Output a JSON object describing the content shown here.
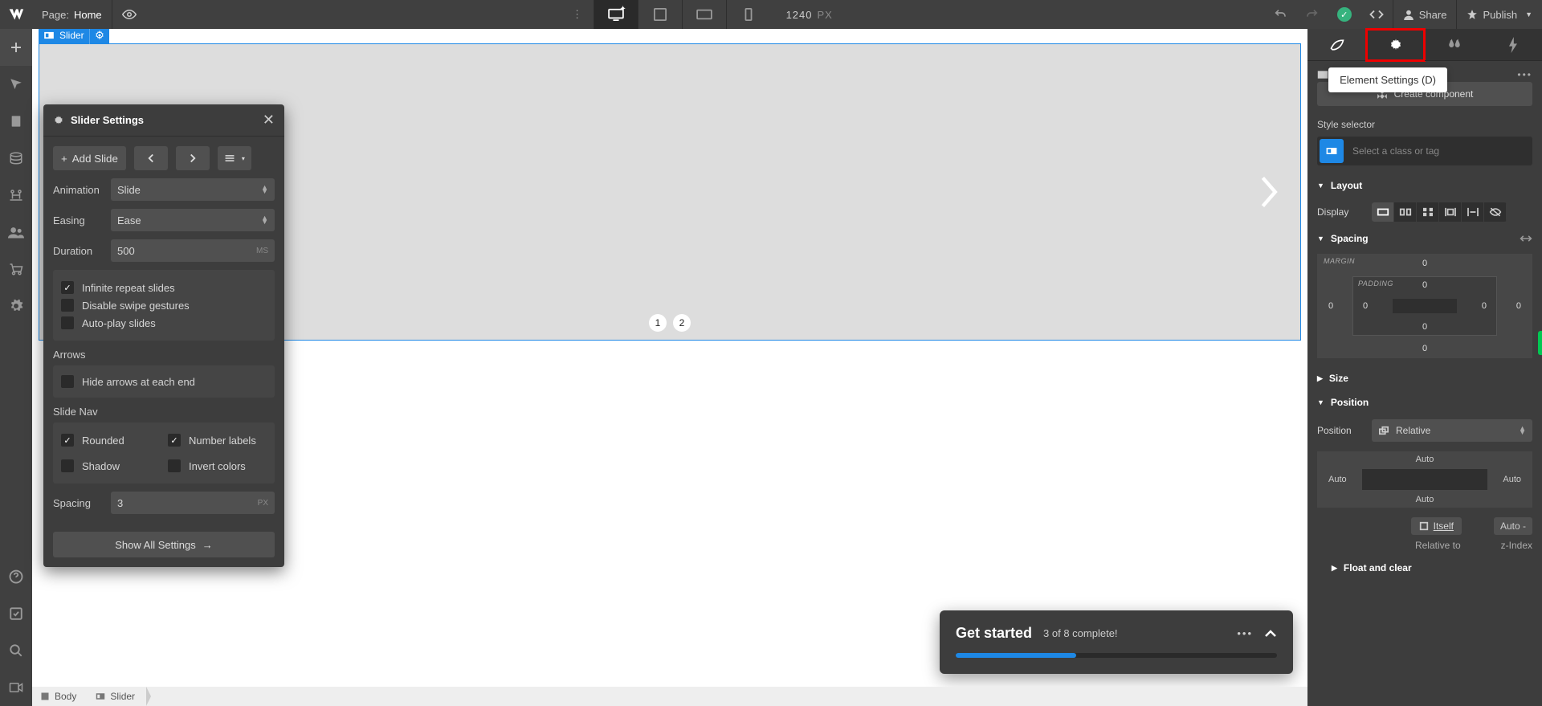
{
  "topbar": {
    "page_label": "Page:",
    "page_value": "Home",
    "width": "1240",
    "width_unit": "PX",
    "share": "Share",
    "publish": "Publish"
  },
  "slider_tag": "Slider",
  "slider_dots": [
    "1",
    "2"
  ],
  "panel": {
    "title": "Slider Settings",
    "add_slide": "Add Slide",
    "animation_lbl": "Animation",
    "animation_val": "Slide",
    "easing_lbl": "Easing",
    "easing_val": "Ease",
    "duration_lbl": "Duration",
    "duration_val": "500",
    "duration_unit": "MS",
    "chk_infinite": "Infinite repeat slides",
    "chk_swipe": "Disable swipe gestures",
    "chk_autoplay": "Auto-play slides",
    "arrows_lbl": "Arrows",
    "chk_hidearr": "Hide arrows at each end",
    "slidenav_lbl": "Slide Nav",
    "chk_rounded": "Rounded",
    "chk_numlbl": "Number labels",
    "chk_shadow": "Shadow",
    "chk_invert": "Invert colors",
    "spacing_lbl": "Spacing",
    "spacing_val": "3",
    "spacing_unit": "PX",
    "show_all": "Show All Settings"
  },
  "gs": {
    "title": "Get started",
    "progress": "3 of 8 complete!"
  },
  "breadcrumb": {
    "body": "Body",
    "slider": "Slider"
  },
  "tooltip": "Element Settings (D)",
  "rpanel": {
    "create_comp": "Create component",
    "style_selector_lbl": "Style selector",
    "style_selector_ph": "Select a class or tag",
    "layout": "Layout",
    "display_lbl": "Display",
    "spacing": "Spacing",
    "margin_lbl": "MARGIN",
    "padding_lbl": "PADDING",
    "size": "Size",
    "position": "Position",
    "position_lbl": "Position",
    "position_val": "Relative",
    "auto": "Auto",
    "itself": "Itself",
    "relative_to": "Relative to",
    "zindex": "z-Index",
    "float": "Float and clear",
    "zero": "0",
    "auto_dash": "Auto  -"
  }
}
